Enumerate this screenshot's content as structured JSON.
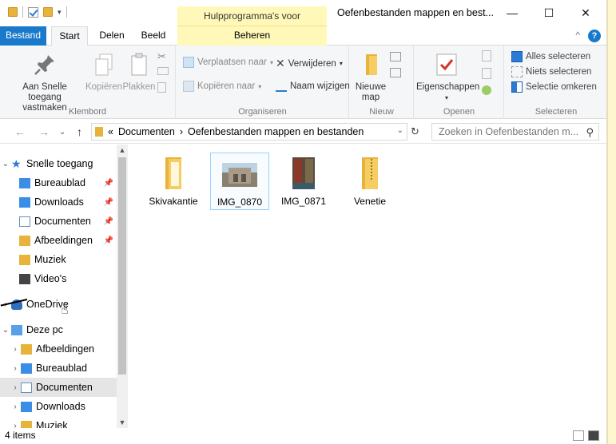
{
  "title_bar": {
    "contextual_tab_title": "Hulpprogramma's voor afbeeldingen",
    "window_title": "Oefenbestanden mappen en best...",
    "minimize": "—",
    "maximize": "☐",
    "close": "✕"
  },
  "tabs": {
    "bestand": "Bestand",
    "start": "Start",
    "delen": "Delen",
    "beeld": "Beeld",
    "beheren": "Beheren"
  },
  "ribbon": {
    "klembord": {
      "label": "Klembord",
      "pin": "Aan Snelle toegang vastmaken",
      "copy": "Kopiëren",
      "paste": "Plakken"
    },
    "organiseren": {
      "label": "Organiseren",
      "move_to": "Verplaatsen naar",
      "copy_to": "Kopiëren naar",
      "delete": "Verwijderen",
      "rename": "Naam wijzigen"
    },
    "nieuw": {
      "label": "Nieuw",
      "new_folder": "Nieuwe map"
    },
    "openen": {
      "label": "Openen",
      "properties": "Eigenschappen"
    },
    "selecteren": {
      "label": "Selecteren",
      "select_all": "Alles selecteren",
      "select_none": "Niets selecteren",
      "invert": "Selectie omkeren"
    }
  },
  "address": {
    "prefix": "«",
    "crumb1": "Documenten",
    "sep": "›",
    "crumb2": "Oefenbestanden mappen en bestanden",
    "search_placeholder": "Zoeken in Oefenbestanden m..."
  },
  "nav": {
    "quick_access": "Snelle toegang",
    "bureaublad": "Bureaublad",
    "downloads": "Downloads",
    "documenten": "Documenten",
    "afbeeldingen": "Afbeeldingen",
    "muziek": "Muziek",
    "videos": "Video's",
    "onedrive": "OneDrive",
    "deze_pc": "Deze pc",
    "pc_afbeeldingen": "Afbeeldingen",
    "pc_bureaublad": "Bureaublad",
    "pc_documenten": "Documenten",
    "pc_downloads": "Downloads",
    "pc_muziek": "Muziek"
  },
  "files": [
    {
      "name": "Skivakantie",
      "type": "folder"
    },
    {
      "name": "IMG_0870",
      "type": "image"
    },
    {
      "name": "IMG_0871",
      "type": "image"
    },
    {
      "name": "Venetie",
      "type": "zip"
    }
  ],
  "status": {
    "count": "4 items"
  },
  "colors": {
    "accent": "#1979ca",
    "folder": "#e8b33b",
    "contextual": "#fff8b8"
  }
}
